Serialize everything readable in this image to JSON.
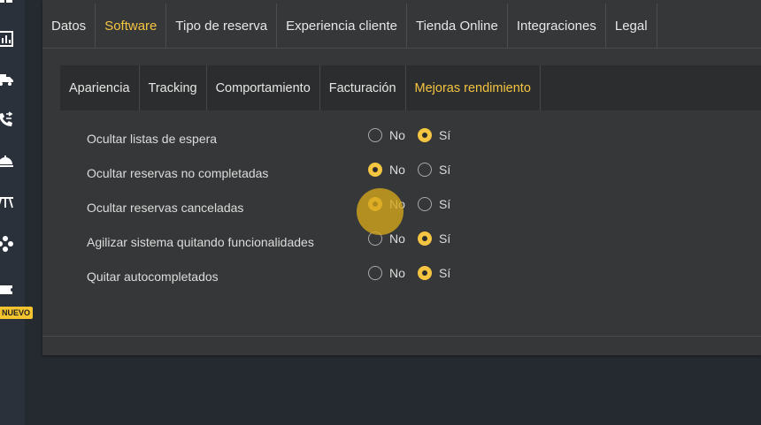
{
  "sidebar": {
    "icons": [
      "dashboard-icon",
      "chart-icon",
      "truck-icon",
      "phone-transfer-icon",
      "cloche-icon",
      "table-icon",
      "gamepad-icon",
      "ticket-icon"
    ],
    "badge": "NUEVO"
  },
  "top_tabs": [
    "Datos",
    "Software",
    "Tipo de reserva",
    "Experiencia cliente",
    "Tienda Online",
    "Integraciones",
    "Legal"
  ],
  "active_top_tab": "Software",
  "sub_tabs": [
    "Apariencia",
    "Tracking",
    "Comportamiento",
    "Facturación",
    "Mejoras rendimiento"
  ],
  "active_sub_tab": "Mejoras rendimiento",
  "settings": [
    {
      "label": "Ocultar listas de espera",
      "no": "No",
      "si": "Sí",
      "selected": "si"
    },
    {
      "label": "Ocultar reservas no completadas",
      "no": "No",
      "si": "Sí",
      "selected": "no"
    },
    {
      "label": "Ocultar reservas canceladas",
      "no": "No",
      "si": "Sí",
      "selected": "no"
    },
    {
      "label": "Agilizar sistema quitando funcionalidades",
      "no": "No",
      "si": "Sí",
      "selected": "si"
    },
    {
      "label": "Quitar autocompletados",
      "no": "No",
      "si": "Sí",
      "selected": "si"
    }
  ],
  "colors": {
    "accent": "#f5c542",
    "panel": "#363738",
    "background": "#252a30"
  }
}
